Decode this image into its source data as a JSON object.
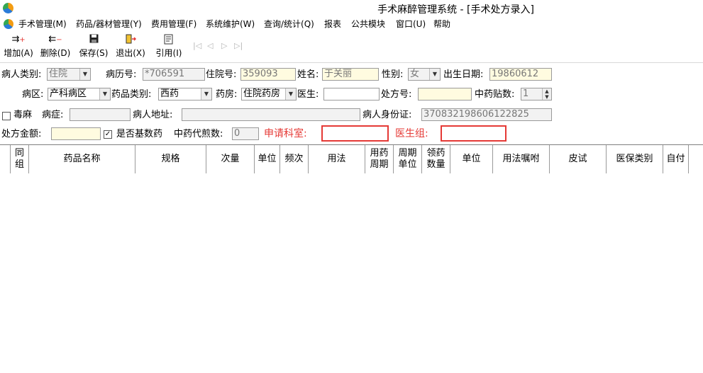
{
  "window": {
    "title": "手术麻醉管理系统 - [手术处方录入]"
  },
  "menu": {
    "items": [
      "手术管理(M)",
      "药品/器材管理(Y)",
      "费用管理(F)",
      "系统维护(W)",
      "查询/统计(Q)",
      "报表",
      "公共模块",
      "窗口(U)",
      "帮助"
    ]
  },
  "toolbar": {
    "add": "增加(A)",
    "delete": "删除(D)",
    "save": "保存(S)",
    "exit": "退出(X)",
    "cite": "引用(I)"
  },
  "form": {
    "patient_type_label": "病人类别:",
    "patient_type": "住院",
    "record_no_label": "病历号:",
    "record_no": "*706591",
    "inpatient_no_label": "住院号:",
    "inpatient_no": "359093",
    "name_label": "姓名:",
    "name": "于关丽",
    "gender_label": "性别:",
    "gender": "女",
    "birth_label": "出生日期:",
    "birth": "19860612",
    "ward_label": "病区:",
    "ward": "产科病区",
    "drug_cat_label": "药品类别:",
    "drug_cat": "西药",
    "pharmacy_label": "药房:",
    "pharmacy": "住院药房",
    "doctor_label": "医生:",
    "doctor": "",
    "rx_no_label": "处方号:",
    "rx_no": "",
    "herb_count_label": "中药贴数:",
    "herb_count": "1",
    "narcotic_label": "毒麻",
    "disease_label": "病症:",
    "disease": "",
    "address_label": "病人地址:",
    "address": "",
    "id_label": "病人身份证:",
    "id_no": "370832198606122825",
    "amount_label": "处方金额:",
    "amount": "",
    "basic_drug_label": "是否基数药",
    "herb_decoct_label": "中药代煎数:",
    "herb_decoct": "0",
    "apply_dept_label": "申请科室:",
    "apply_dept": "",
    "doctor_group_label": "医生组:",
    "doctor_group": ""
  },
  "grid": {
    "columns": [
      "同组",
      "药品名称",
      "规格",
      "次量",
      "单位",
      "频次",
      "用法",
      "用药周期",
      "周期单位",
      "领药数量",
      "单位",
      "用法嘱咐",
      "皮试",
      "医保类别",
      "自付"
    ]
  },
  "colors": {
    "accent_red": "#e53935",
    "readonly_yellow": "#fffbe0"
  }
}
